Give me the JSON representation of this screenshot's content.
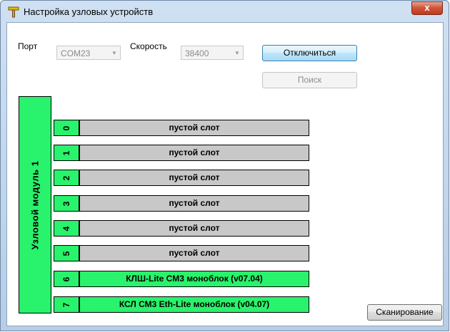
{
  "window": {
    "title": "Настройка узловых устройств",
    "close_label": "x"
  },
  "toolbar": {
    "port_label": "Порт",
    "port_value": "COM23",
    "speed_label": "Скорость",
    "speed_value": "38400",
    "disconnect_label": "Отключиться",
    "search_label": "Поиск"
  },
  "module": {
    "label": "Узловой модуль 1",
    "slots": [
      {
        "num": "0",
        "label": "пустой слот",
        "empty": true
      },
      {
        "num": "1",
        "label": "пустой слот",
        "empty": true
      },
      {
        "num": "2",
        "label": "пустой слот",
        "empty": true
      },
      {
        "num": "3",
        "label": "пустой слот",
        "empty": true
      },
      {
        "num": "4",
        "label": "пустой слот",
        "empty": true
      },
      {
        "num": "5",
        "label": "пустой слот",
        "empty": true
      },
      {
        "num": "6",
        "label": "КЛШ-Lite СМ3 моноблок (v07.04)",
        "empty": false
      },
      {
        "num": "7",
        "label": "КСЛ СМ3 Eth-Lite моноблок (v04.07)",
        "empty": false
      }
    ]
  },
  "scan_label": "Сканирование",
  "colors": {
    "slot_active": "#29f26c",
    "slot_empty": "#c8c8c8",
    "title_bar": "#cfe0f2"
  }
}
